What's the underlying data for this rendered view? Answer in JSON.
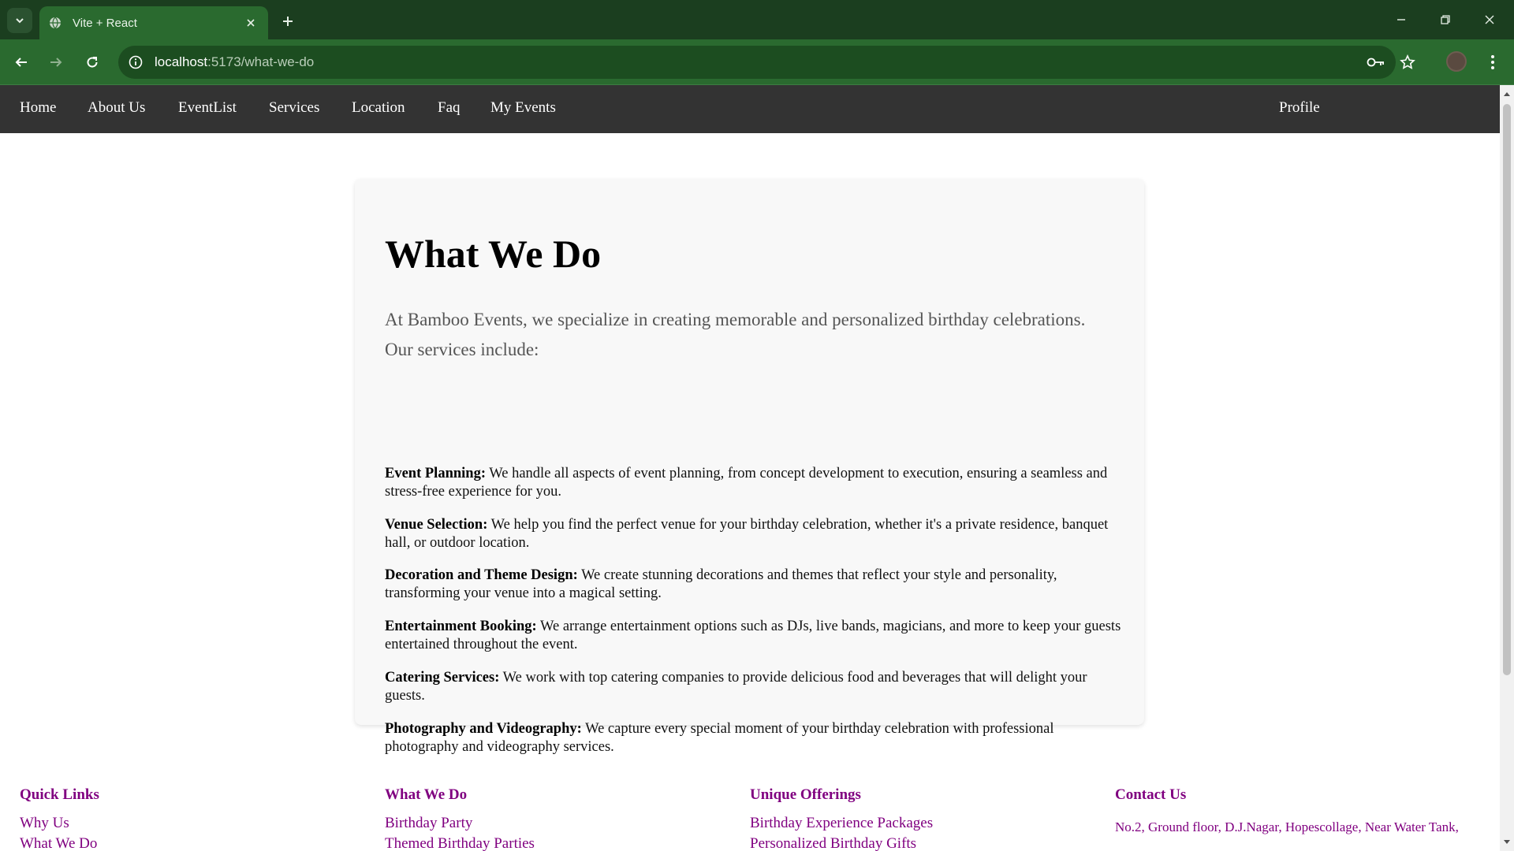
{
  "browser": {
    "tab_title": "Vite + React",
    "url_host": "localhost",
    "url_path": ":5173/what-we-do"
  },
  "site_nav": {
    "items": [
      "Home",
      "About Us",
      "EventList",
      "Services",
      "Location",
      "Faq",
      "My Events"
    ],
    "profile": "Profile"
  },
  "content": {
    "title": "What We Do",
    "intro": "At Bamboo Events, we specialize in creating memorable and personalized birthday celebrations. Our services include:",
    "services": [
      {
        "name": "Event Planning:",
        "desc": " We handle all aspects of event planning, from concept development to execution, ensuring a seamless and stress-free experience for you."
      },
      {
        "name": "Venue Selection:",
        "desc": " We help you find the perfect venue for your birthday celebration, whether it's a private residence, banquet hall, or outdoor location."
      },
      {
        "name": "Decoration and Theme Design:",
        "desc": " We create stunning decorations and themes that reflect your style and personality, transforming your venue into a magical setting."
      },
      {
        "name": "Entertainment Booking:",
        "desc": " We arrange entertainment options such as DJs, live bands, magicians, and more to keep your guests entertained throughout the event."
      },
      {
        "name": "Catering Services:",
        "desc": " We work with top catering companies to provide delicious food and beverages that will delight your guests."
      },
      {
        "name": "Photography and Videography:",
        "desc": " We capture every special moment of your birthday celebration with professional photography and videography services."
      }
    ]
  },
  "footer": {
    "quick_links": {
      "heading": "Quick Links",
      "items": [
        "Why Us",
        "What We Do"
      ]
    },
    "what_we_do": {
      "heading": "What We Do",
      "items": [
        "Birthday Party",
        "Themed Birthday Parties"
      ]
    },
    "unique_offerings": {
      "heading": "Unique Offerings",
      "items": [
        "Birthday Experience Packages",
        "Personalized Birthday Gifts"
      ]
    },
    "contact": {
      "heading": "Contact Us",
      "address": "No.2, Ground floor, D.J.Nagar, Hopescollage, Near Water Tank,"
    }
  },
  "colors": {
    "nav_bg": "#333333",
    "footer_link": "#800080",
    "browser_frame": "#2a6a2f"
  }
}
